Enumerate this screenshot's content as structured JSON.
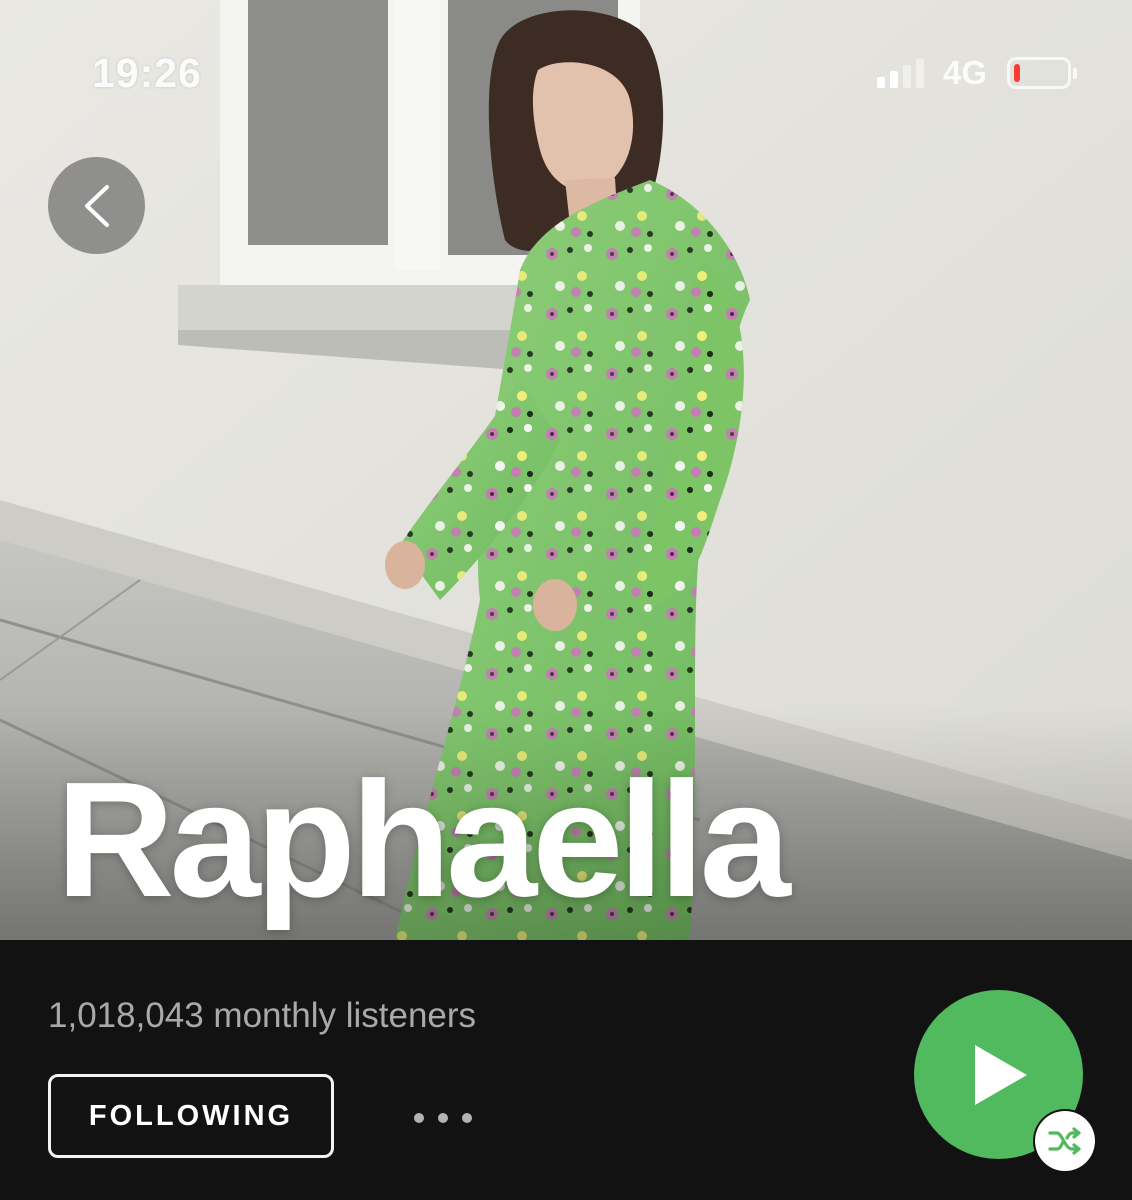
{
  "status_bar": {
    "time": "19:26",
    "network": "4G",
    "signal_bars_active": 2,
    "battery_level": 0.1,
    "battery_color": "#ff3b30"
  },
  "artist": {
    "name": "Raphaella",
    "monthly_listeners": "1,018,043 monthly listeners"
  },
  "actions": {
    "follow_label": "FOLLOWING"
  },
  "icons": {
    "back": "chevron-left-icon",
    "more": "ellipsis-icon",
    "play": "play-icon",
    "shuffle": "shuffle-icon"
  },
  "colors": {
    "background": "#121212",
    "play_button": "#51b95e",
    "listeners_text": "#a9a9a9"
  }
}
